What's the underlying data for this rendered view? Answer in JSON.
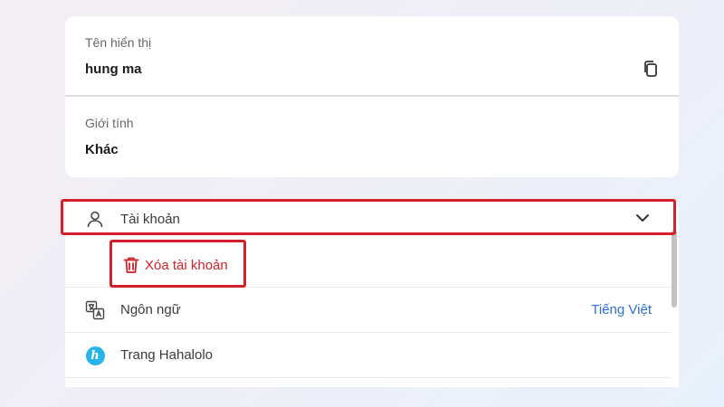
{
  "profile": {
    "display_name": {
      "label": "Tên hiển thị",
      "value": "hung ma"
    },
    "gender": {
      "label": "Giới tính",
      "value": "Khác"
    }
  },
  "settings": {
    "account": {
      "label": "Tài khoản"
    },
    "delete_account": {
      "label": "Xóa tài khoản"
    },
    "language": {
      "label": "Ngôn ngữ",
      "value": "Tiếng Việt"
    },
    "hahalolo_page": {
      "label": "Trang Hahalolo",
      "logo_letter": "h"
    }
  },
  "colors": {
    "danger": "#d1232a",
    "link": "#2f6fd6",
    "hahalolo_brand": "#27b4ec",
    "highlight_box": "#d4202a"
  },
  "icons": {
    "copy": "copy-icon",
    "account": "user-icon",
    "expand": "chevron-down-icon",
    "delete": "trash-icon",
    "language": "translate-icon",
    "page": "hahalolo-logo-icon"
  }
}
